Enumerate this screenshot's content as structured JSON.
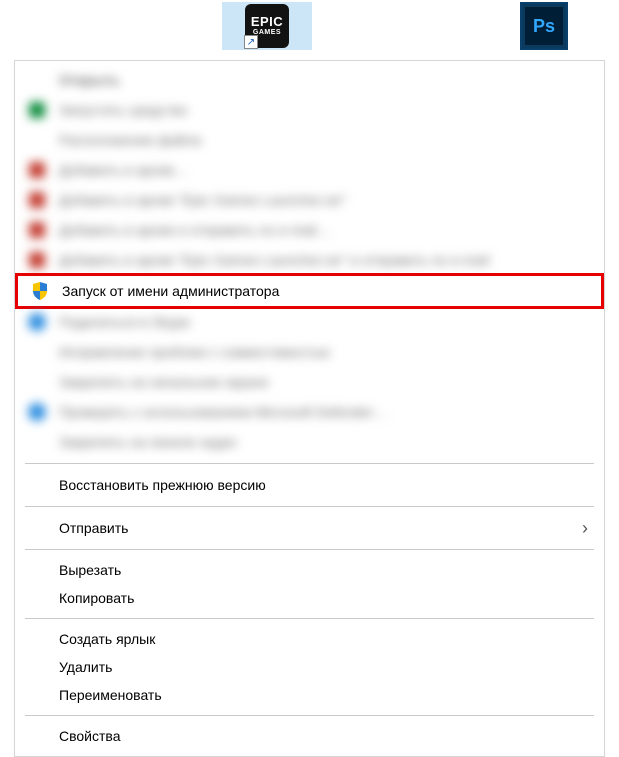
{
  "desktop": {
    "epic": {
      "line1": "EPIC",
      "line2": "GAMES"
    },
    "ps": {
      "label": "Ps"
    }
  },
  "menu": {
    "header": "Открыть",
    "blurred_block1": [
      "Запустить средство",
      "Расположение файла",
      "Добавить в архив…",
      "Добавить в архив \"Epic Games Launcher.rar\"",
      "Добавить в архив и отправить по e-mail…",
      "Добавить в архив \"Epic Games Launcher.rar\" и отправить по e-mail"
    ],
    "run_as_admin": "Запуск от имени администратора",
    "blurred_block2": [
      "Поделиться в Skype",
      "Исправление проблем с совместимостью",
      "Закрепить на начальном экране",
      "Проверить с использованием Microsoft Defender…",
      "Закрепить на панели задач"
    ],
    "restore_prev": "Восстановить прежнюю версию",
    "send_to": "Отправить",
    "cut": "Вырезать",
    "copy_item": "Копировать",
    "create_shortcut": "Создать ярлык",
    "delete_item": "Удалить",
    "rename": "Переименовать",
    "properties": "Свойства"
  }
}
